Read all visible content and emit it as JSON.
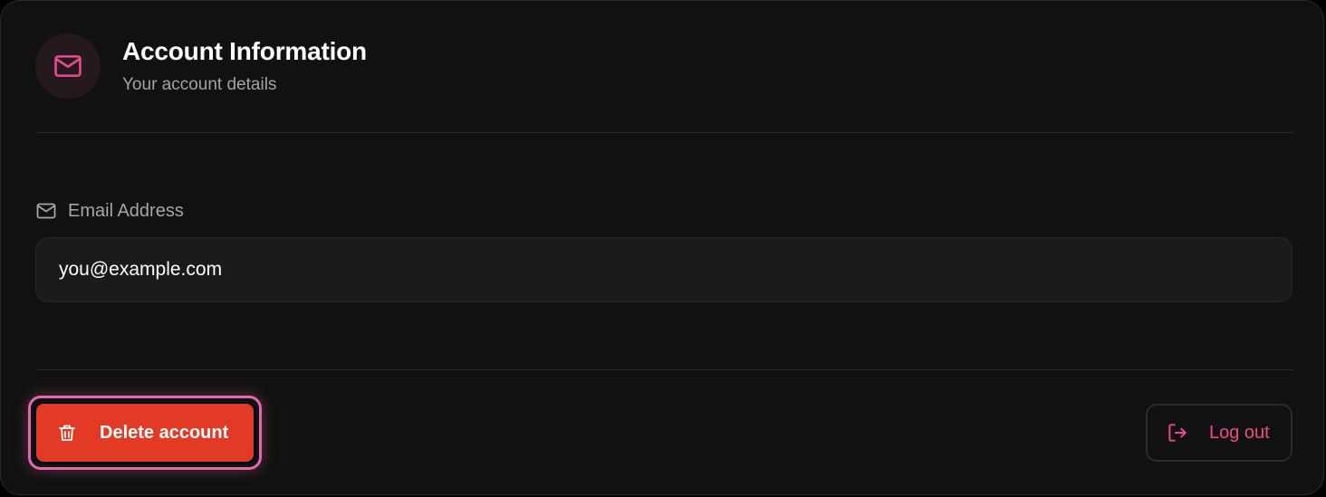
{
  "header": {
    "title": "Account Information",
    "subtitle": "Your account details",
    "icon": "mail-icon"
  },
  "email": {
    "label": "Email Address",
    "label_icon": "mail-icon",
    "value": "you@example.com"
  },
  "actions": {
    "delete_label": "Delete account",
    "delete_icon": "trash-icon",
    "logout_label": "Log out",
    "logout_icon": "logout-icon"
  },
  "colors": {
    "background": "#111111",
    "accent_pink": "#ec4b93",
    "danger_red": "#e23a24",
    "focus_ring": "#e36aa8"
  }
}
